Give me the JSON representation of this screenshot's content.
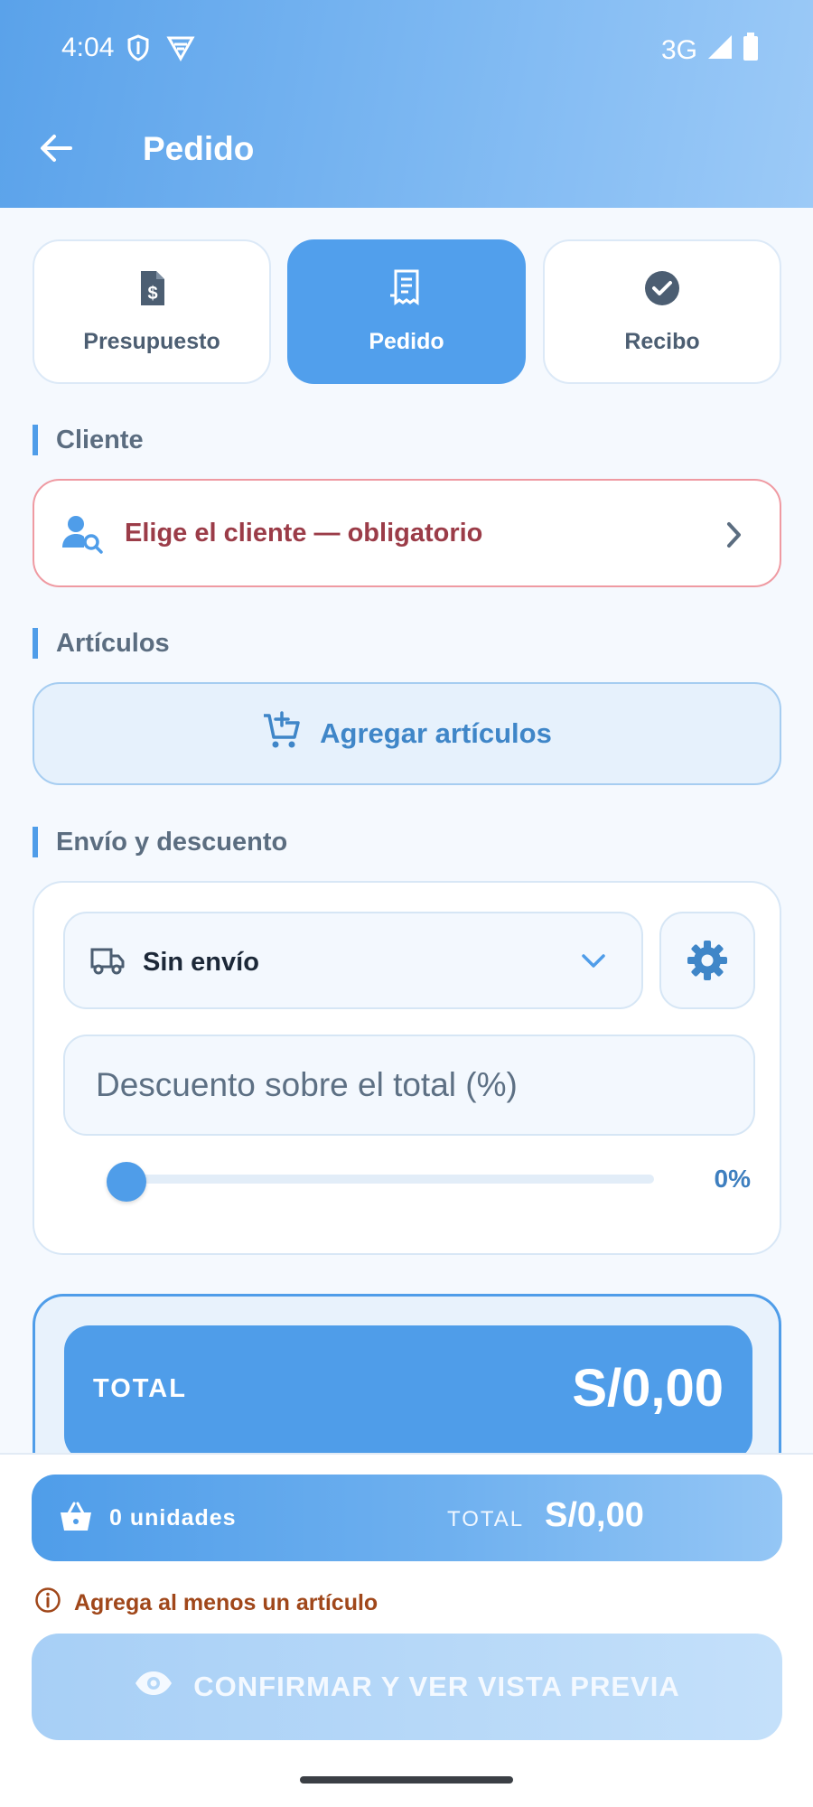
{
  "status_bar": {
    "time": "4:04",
    "network": "3G"
  },
  "appbar": {
    "title": "Pedido"
  },
  "tabs": [
    {
      "label": "Presupuesto",
      "icon": "invoice-dollar-icon",
      "active": false
    },
    {
      "label": "Pedido",
      "icon": "receipt-icon",
      "active": true
    },
    {
      "label": "Recibo",
      "icon": "check-circle-icon",
      "active": false
    }
  ],
  "client": {
    "section_label": "Cliente",
    "select_text": "Elige el cliente — obligatorio"
  },
  "items": {
    "section_label": "Artículos",
    "add_label": "Agregar artículos"
  },
  "shipping": {
    "section_label": "Envío y descuento",
    "selected_option": "Sin envío",
    "discount_placeholder": "Descuento sobre el total (%)",
    "discount_value": "0%",
    "discount_fraction": 0
  },
  "total": {
    "label": "TOTAL",
    "amount": "S/0,00"
  },
  "summary": {
    "units": "0 unidades",
    "total_label": "TOTAL",
    "total_amount": "S/0,00"
  },
  "warning": {
    "text": "Agrega al menos un artículo"
  },
  "confirm": {
    "label": "CONFIRMAR Y VER VISTA PREVIA"
  },
  "colors": {
    "accent": "#4f9de9",
    "error_border": "#ef9aa2",
    "error_text": "#9b3c48",
    "warning_text": "#a0471a"
  }
}
